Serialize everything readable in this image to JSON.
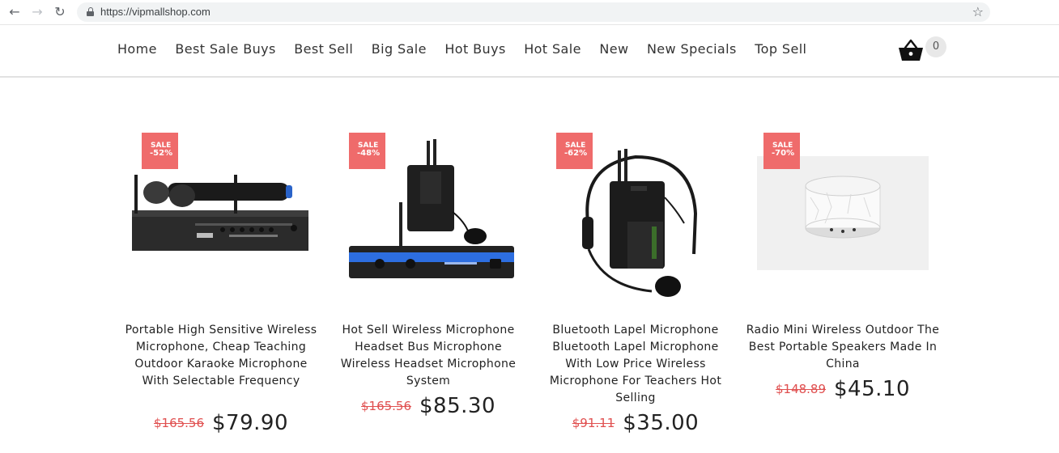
{
  "browser": {
    "url": "https://vipmallshop.com"
  },
  "nav": {
    "items": [
      "Home",
      "Best Sale Buys",
      "Best Sell",
      "Big Sale",
      "Hot Buys",
      "Hot Sale",
      "New",
      "New Specials",
      "Top Sell"
    ]
  },
  "cart": {
    "count": "0",
    "icon": "basket-icon"
  },
  "colors": {
    "sale_badge": "#ef6b6b",
    "old_price": "#e05050"
  },
  "products": [
    {
      "badge_label": "SALE",
      "badge_pct": "-52%",
      "title": "Portable High Sensitive Wireless Microphone, Cheap Teaching Outdoor Karaoke Microphone With Selectable Frequency",
      "old_price": "$165.56",
      "new_price": "$79.90"
    },
    {
      "badge_label": "SALE",
      "badge_pct": "-48%",
      "title": "Hot Sell Wireless Microphone Headset Bus Microphone Wireless Headset Microphone System",
      "old_price": "$165.56",
      "new_price": "$85.30"
    },
    {
      "badge_label": "SALE",
      "badge_pct": "-62%",
      "title": "Bluetooth Lapel Microphone Bluetooth Lapel Microphone With Low Price Wireless Microphone For Teachers Hot Selling",
      "old_price": "$91.11",
      "new_price": "$35.00"
    },
    {
      "badge_label": "SALE",
      "badge_pct": "-70%",
      "title": "Radio Mini Wireless Outdoor The Best Portable Speakers Made In China",
      "old_price": "$148.89",
      "new_price": "$45.10"
    }
  ]
}
